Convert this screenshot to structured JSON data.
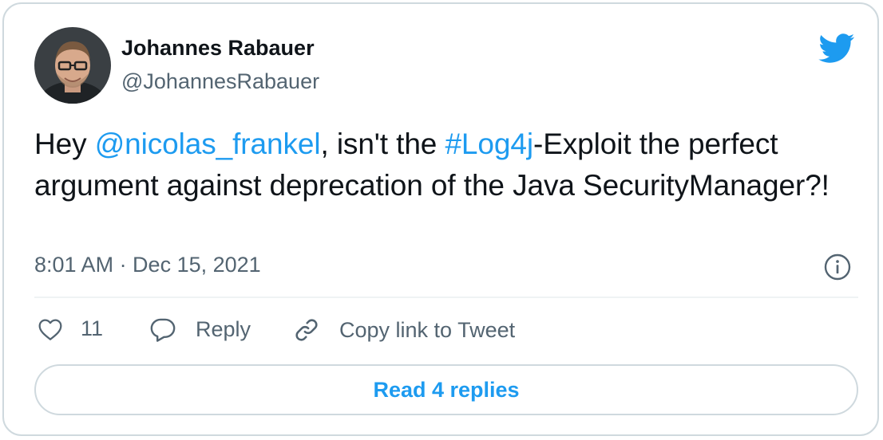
{
  "tweet": {
    "author": {
      "name": "Johannes Rabauer",
      "handle": "@JohannesRabauer",
      "avatar": "user-avatar-photo"
    },
    "logo_icon": "twitter-bird-icon",
    "text": {
      "part1": "Hey ",
      "mention": "@nicolas_frankel",
      "part2": ", isn't the ",
      "hashtag": "#Log4j",
      "part3": "-Exploit the perfect argument against deprecation of the Java SecurityManager?!"
    },
    "timestamp": "8:01 AM · Dec 15, 2021",
    "info_icon": "info-icon",
    "actions": {
      "like_count": "11",
      "reply_label": "Reply",
      "copy_link_label": "Copy link to Tweet"
    },
    "read_replies_label": "Read 4 replies",
    "colors": {
      "accent": "#1d9bf0",
      "text": "#0f1419",
      "secondary": "#536471",
      "border": "#cfd9de"
    }
  }
}
